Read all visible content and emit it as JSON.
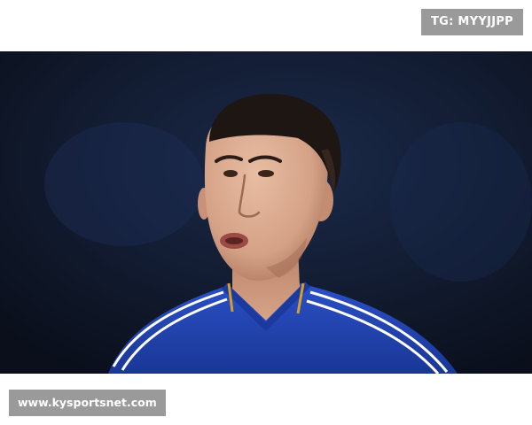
{
  "watermark_top": {
    "text": "TG: MYYJJPP"
  },
  "watermark_bottom": {
    "text": "www.kysportsnet.com"
  },
  "photo": {
    "subject": "footballer-portrait",
    "colors": {
      "background": "#0d1422",
      "jersey": "#2346b8",
      "stripes": "#ffffff",
      "trim": "#d4a02a",
      "skin": "#d9a98c",
      "hair": "#1e1612"
    }
  }
}
